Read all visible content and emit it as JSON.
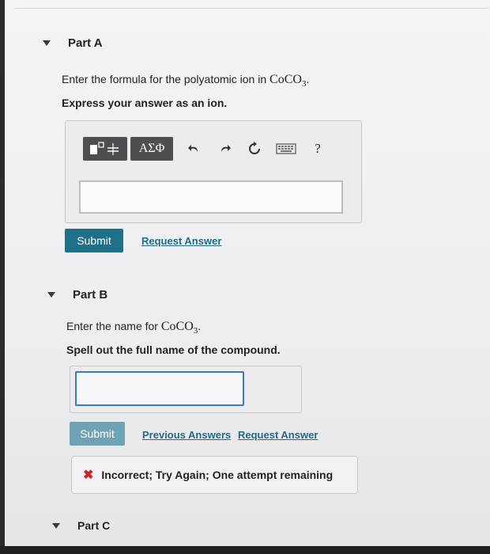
{
  "part_a": {
    "title": "Part A",
    "prompt_prefix": "Enter the formula for the polyatomic ion in ",
    "compound_main": "CoCO",
    "compound_sub": "3",
    "compound_dot": ".",
    "instruction": "Express your answer as an ion.",
    "toolbar": {
      "templates_icon": "templates-icon",
      "greek_label": "ΑΣΦ",
      "undo_icon": "undo-icon",
      "redo_icon": "redo-icon",
      "reset_icon": "reset-icon",
      "keyboard_icon": "keyboard-icon",
      "help_label": "?"
    },
    "answer_value": "",
    "submit_label": "Submit",
    "request_answer_label": "Request Answer"
  },
  "part_b": {
    "title": "Part B",
    "prompt_prefix": "Enter the name for ",
    "compound_main": "CoCO",
    "compound_sub": "3",
    "compound_dot": ".",
    "instruction": "Spell out the full name of the compound.",
    "answer_value": "",
    "submit_label": "Submit",
    "previous_answers_label": "Previous Answers",
    "request_answer_label": "Request Answer",
    "feedback": {
      "icon": "x-mark-icon",
      "text": "Incorrect; Try Again; One attempt remaining",
      "color": "#c62828"
    }
  },
  "part_c": {
    "title": "Part C"
  },
  "colors": {
    "submit": "#1d7088",
    "link": "#1d6b8c",
    "input_focus": "#3a78c9"
  }
}
